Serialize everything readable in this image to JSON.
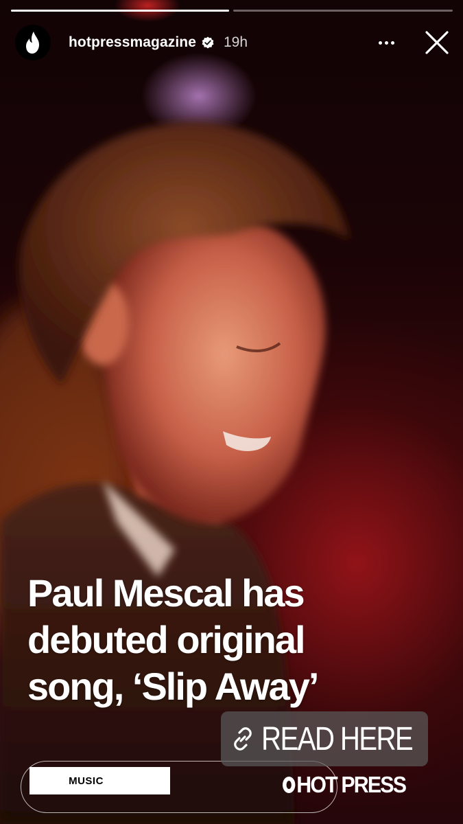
{
  "story": {
    "progress": [
      1.0,
      0.0
    ],
    "username": "hotpressmagazine",
    "time": "19h",
    "verified": true
  },
  "icons": {
    "avatar": "flame-logo-icon",
    "verified": "verified-badge-icon",
    "more": "more-dots-icon",
    "close": "close-icon",
    "link": "link-icon"
  },
  "headline": {
    "lines": [
      "Paul Mescal has",
      "debuted original",
      "song, ‘Slip Away’"
    ]
  },
  "link_sticker": {
    "label": "READ HERE"
  },
  "music_sticker": {
    "label": "MUSIC"
  },
  "brand": {
    "o": "O",
    "text": "HOT PRESS"
  },
  "colors": {
    "background": "#1a0406",
    "accent": "#9a1418",
    "text": "#ffffff"
  }
}
